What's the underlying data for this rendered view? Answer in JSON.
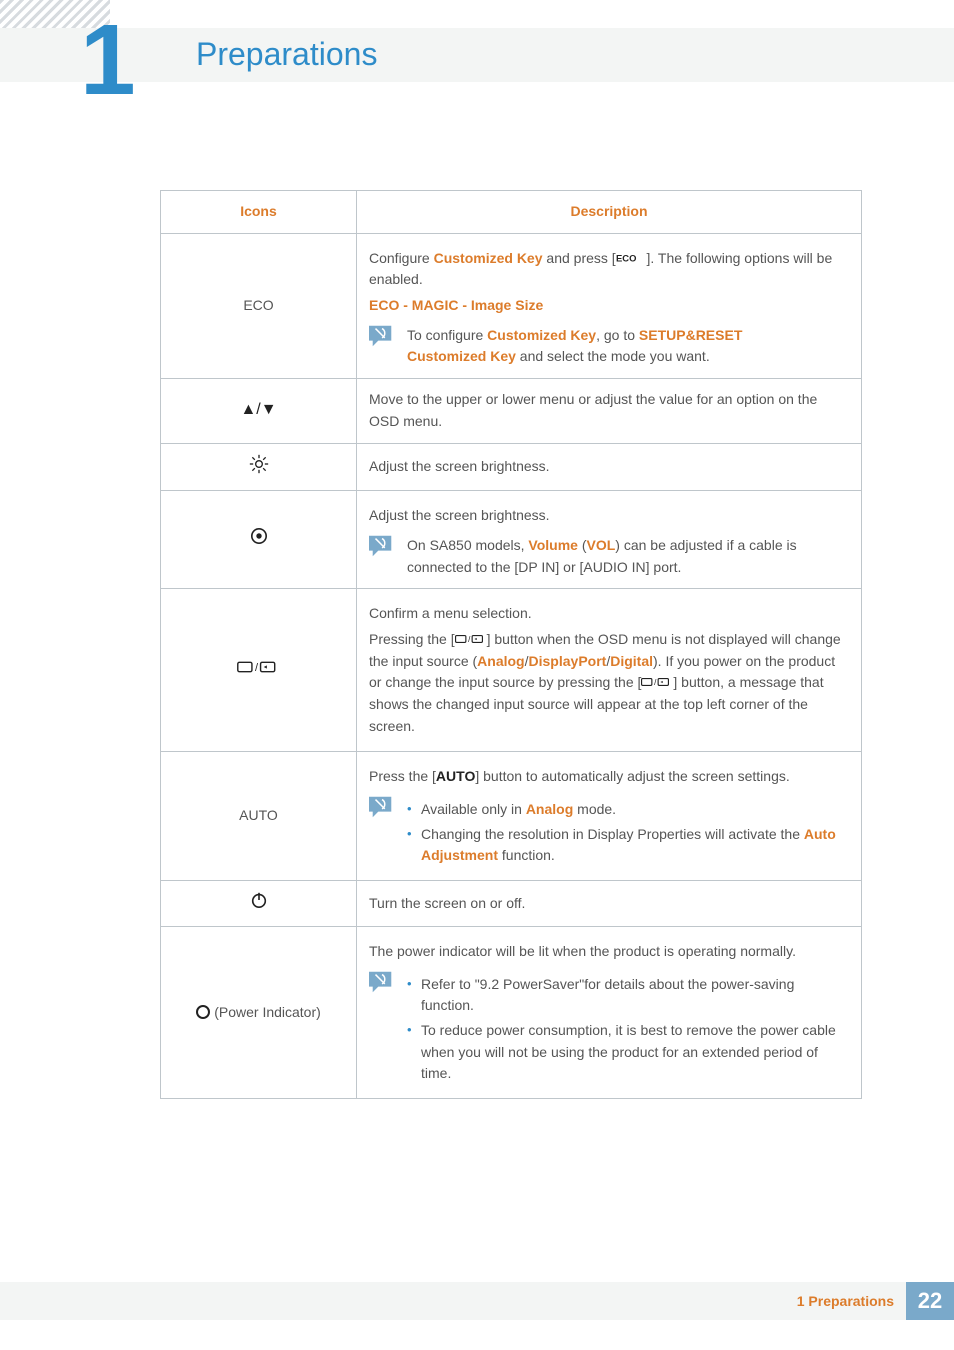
{
  "chapter": {
    "number": "1",
    "title": "Preparations"
  },
  "table": {
    "headers": {
      "icons": "Icons",
      "desc": "Description"
    },
    "rows": {
      "eco": {
        "label": "ECO",
        "p1a": "Configure ",
        "p1b": "Customized Key",
        "p1c": " and press [",
        "p1d": "]. The following options will be enabled.",
        "line2": "ECO - MAGIC - Image Size",
        "note_a": "To configure ",
        "note_b": "Customized Key",
        "note_c": ", go to ",
        "note_d": "SETUP&RESET",
        "note_e": "Customized Key",
        "note_f": " and select the mode you want."
      },
      "updown": {
        "sym": "▲/▼",
        "text": "Move to the upper or lower menu or adjust the value for an option on the OSD menu."
      },
      "bright": {
        "text": "Adjust the screen brightness."
      },
      "vol": {
        "p1": "Adjust the screen brightness.",
        "note_a": "On SA850 models, ",
        "note_b": "Volume",
        "note_c": " (",
        "note_d": "VOL",
        "note_e": ") can be adjusted if a cable is connected to the [DP IN] or [AUDIO IN] port."
      },
      "enter": {
        "p1": "Confirm a menu selection.",
        "p2a": "Pressing the [",
        "p2b": "] button when the OSD menu is not displayed will change the input source (",
        "p2c": "Analog",
        "p2d": "/",
        "p2e": "DisplayPort",
        "p2f": "/",
        "p2g": "Digital",
        "p2h": "). If you power on the product or change the input source by pressing the [",
        "p2i": "] button, a message that shows the changed input source will appear at the top left corner of the screen."
      },
      "auto": {
        "label": "AUTO",
        "p1a": "Press the [",
        "p1b": "AUTO",
        "p1c": "] button to automatically adjust the screen settings.",
        "b1a": "Available only in ",
        "b1b": "Analog",
        "b1c": " mode.",
        "b2a": "Changing the resolution in Display Properties will activate the ",
        "b2b": "Auto Adjustment",
        "b2c": " function."
      },
      "power": {
        "text": "Turn the screen on or off."
      },
      "indicator": {
        "label": "(Power Indicator)",
        "p1": "The power indicator will be lit when the product is operating normally.",
        "b1": "Refer to \"9.2 PowerSaver\"for details about the power-saving function.",
        "b2": "To reduce power consumption, it is best to remove the power cable when you will not be using the product for an extended period of time."
      }
    }
  },
  "footer": {
    "text": "1 Preparations",
    "page": "22"
  }
}
